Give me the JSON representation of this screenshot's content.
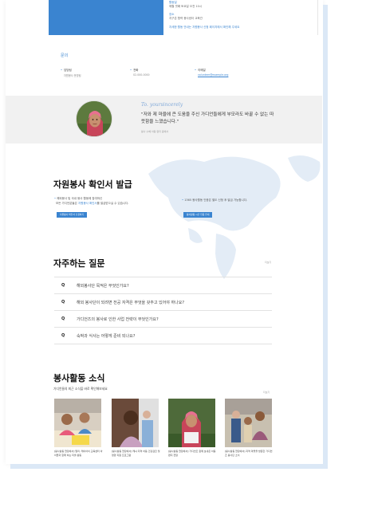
{
  "top_card": {
    "label1": "활동일",
    "text1": "매월 셋째 토요일 오전 10시",
    "label2": "장소",
    "text2": "지구촌 협력 봉사센터 교육관",
    "link": "자세한 활동 안내는 자원봉사 신청 페이지에서 확인해 주세요"
  },
  "contact": {
    "title": "문의",
    "items": [
      {
        "label": "담당팀",
        "value": "자원봉사 운영팀"
      },
      {
        "label": "전화",
        "value": "02-000-0000"
      },
      {
        "label": "이메일",
        "value": "volunteer@example.org"
      }
    ]
  },
  "testimonial": {
    "signature": "To. yoursincerely",
    "quote": "\"저와 제 마을에 큰 도움을 주신 가디언들에게 부모라도 바꿀 수 없는 따뜻함을 느꼈습니다.\"",
    "source": "봉사 수혜 아동 편지 중에서"
  },
  "certificate": {
    "title": "자원봉사 확인서 발급",
    "left_text_1": "해외봉사 및 국내 봉사 활동에 참여하신",
    "left_text_2a": "모든 가디언분들은 ",
    "left_text_2b": "자원봉사 확인서",
    "left_text_2c": "를 발급받으실 수 있습니다.",
    "left_button": "자원봉사 확인서 신청하기",
    "right_text": "1365 봉사활동 인증은 별도 신청 후 발급 가능합니다.",
    "right_button": "봉사활동 시간 인증 안내"
  },
  "faq": {
    "title": "자주하는 질문",
    "more": "더보기",
    "q_mark": "Q",
    "items": [
      "해외봉사단 목적은 무엇인가요?",
      "해외 봉사단이 되려면 전공 자격은 무엇을 갖추고 있어야 하나요?",
      "가디언즈의 봉사로 인한 사업 전략이 무엇인가요?",
      "숙박과 식사는 어떻게 준비 되나요?"
    ]
  },
  "news": {
    "title": "봉사활동 소식",
    "subtitle": "가디언들의 최근 소식을 바로 확인해보세요",
    "more": "더보기",
    "items": [
      "[봉사활동 현장에서] 말리, 케이아이 교육센터 아이들과 함께 하는 미술 활동",
      "[봉사활동 현장에서] 케냐 지역 아동 건강검진 및 영양 지원 프로그램",
      "[봉사활동 현장에서] 가디언즈 함께 보내온 아동 편지 전달",
      "[봉사활동 현장에서] 지역 마을을 방문한 가디언즈 봉사단 소식"
    ]
  },
  "colors": {
    "accent": "#3a84d0",
    "band": "#f1f1f1"
  }
}
